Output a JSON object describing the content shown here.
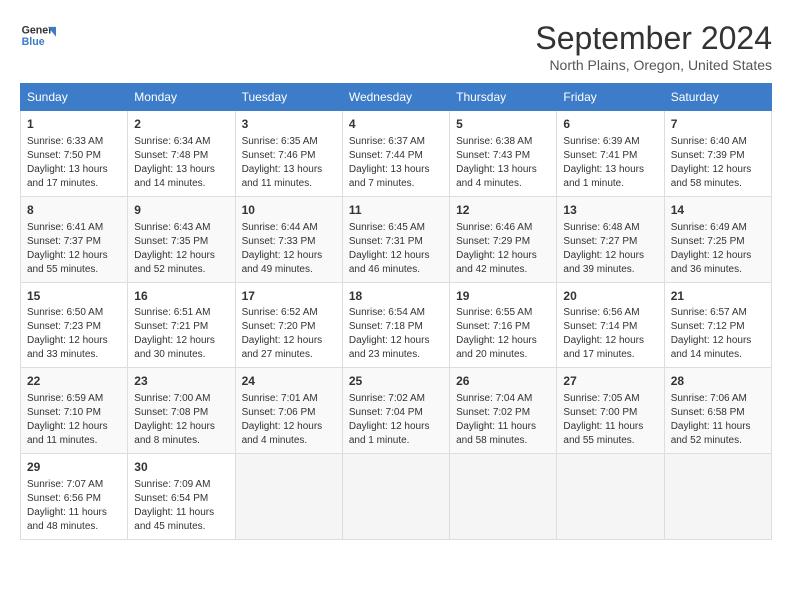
{
  "header": {
    "logo_line1": "General",
    "logo_line2": "Blue",
    "month": "September 2024",
    "location": "North Plains, Oregon, United States"
  },
  "weekdays": [
    "Sunday",
    "Monday",
    "Tuesday",
    "Wednesday",
    "Thursday",
    "Friday",
    "Saturday"
  ],
  "weeks": [
    [
      {
        "day": "1",
        "lines": [
          "Sunrise: 6:33 AM",
          "Sunset: 7:50 PM",
          "Daylight: 13 hours",
          "and 17 minutes."
        ]
      },
      {
        "day": "2",
        "lines": [
          "Sunrise: 6:34 AM",
          "Sunset: 7:48 PM",
          "Daylight: 13 hours",
          "and 14 minutes."
        ]
      },
      {
        "day": "3",
        "lines": [
          "Sunrise: 6:35 AM",
          "Sunset: 7:46 PM",
          "Daylight: 13 hours",
          "and 11 minutes."
        ]
      },
      {
        "day": "4",
        "lines": [
          "Sunrise: 6:37 AM",
          "Sunset: 7:44 PM",
          "Daylight: 13 hours",
          "and 7 minutes."
        ]
      },
      {
        "day": "5",
        "lines": [
          "Sunrise: 6:38 AM",
          "Sunset: 7:43 PM",
          "Daylight: 13 hours",
          "and 4 minutes."
        ]
      },
      {
        "day": "6",
        "lines": [
          "Sunrise: 6:39 AM",
          "Sunset: 7:41 PM",
          "Daylight: 13 hours",
          "and 1 minute."
        ]
      },
      {
        "day": "7",
        "lines": [
          "Sunrise: 6:40 AM",
          "Sunset: 7:39 PM",
          "Daylight: 12 hours",
          "and 58 minutes."
        ]
      }
    ],
    [
      {
        "day": "8",
        "lines": [
          "Sunrise: 6:41 AM",
          "Sunset: 7:37 PM",
          "Daylight: 12 hours",
          "and 55 minutes."
        ]
      },
      {
        "day": "9",
        "lines": [
          "Sunrise: 6:43 AM",
          "Sunset: 7:35 PM",
          "Daylight: 12 hours",
          "and 52 minutes."
        ]
      },
      {
        "day": "10",
        "lines": [
          "Sunrise: 6:44 AM",
          "Sunset: 7:33 PM",
          "Daylight: 12 hours",
          "and 49 minutes."
        ]
      },
      {
        "day": "11",
        "lines": [
          "Sunrise: 6:45 AM",
          "Sunset: 7:31 PM",
          "Daylight: 12 hours",
          "and 46 minutes."
        ]
      },
      {
        "day": "12",
        "lines": [
          "Sunrise: 6:46 AM",
          "Sunset: 7:29 PM",
          "Daylight: 12 hours",
          "and 42 minutes."
        ]
      },
      {
        "day": "13",
        "lines": [
          "Sunrise: 6:48 AM",
          "Sunset: 7:27 PM",
          "Daylight: 12 hours",
          "and 39 minutes."
        ]
      },
      {
        "day": "14",
        "lines": [
          "Sunrise: 6:49 AM",
          "Sunset: 7:25 PM",
          "Daylight: 12 hours",
          "and 36 minutes."
        ]
      }
    ],
    [
      {
        "day": "15",
        "lines": [
          "Sunrise: 6:50 AM",
          "Sunset: 7:23 PM",
          "Daylight: 12 hours",
          "and 33 minutes."
        ]
      },
      {
        "day": "16",
        "lines": [
          "Sunrise: 6:51 AM",
          "Sunset: 7:21 PM",
          "Daylight: 12 hours",
          "and 30 minutes."
        ]
      },
      {
        "day": "17",
        "lines": [
          "Sunrise: 6:52 AM",
          "Sunset: 7:20 PM",
          "Daylight: 12 hours",
          "and 27 minutes."
        ]
      },
      {
        "day": "18",
        "lines": [
          "Sunrise: 6:54 AM",
          "Sunset: 7:18 PM",
          "Daylight: 12 hours",
          "and 23 minutes."
        ]
      },
      {
        "day": "19",
        "lines": [
          "Sunrise: 6:55 AM",
          "Sunset: 7:16 PM",
          "Daylight: 12 hours",
          "and 20 minutes."
        ]
      },
      {
        "day": "20",
        "lines": [
          "Sunrise: 6:56 AM",
          "Sunset: 7:14 PM",
          "Daylight: 12 hours",
          "and 17 minutes."
        ]
      },
      {
        "day": "21",
        "lines": [
          "Sunrise: 6:57 AM",
          "Sunset: 7:12 PM",
          "Daylight: 12 hours",
          "and 14 minutes."
        ]
      }
    ],
    [
      {
        "day": "22",
        "lines": [
          "Sunrise: 6:59 AM",
          "Sunset: 7:10 PM",
          "Daylight: 12 hours",
          "and 11 minutes."
        ]
      },
      {
        "day": "23",
        "lines": [
          "Sunrise: 7:00 AM",
          "Sunset: 7:08 PM",
          "Daylight: 12 hours",
          "and 8 minutes."
        ]
      },
      {
        "day": "24",
        "lines": [
          "Sunrise: 7:01 AM",
          "Sunset: 7:06 PM",
          "Daylight: 12 hours",
          "and 4 minutes."
        ]
      },
      {
        "day": "25",
        "lines": [
          "Sunrise: 7:02 AM",
          "Sunset: 7:04 PM",
          "Daylight: 12 hours",
          "and 1 minute."
        ]
      },
      {
        "day": "26",
        "lines": [
          "Sunrise: 7:04 AM",
          "Sunset: 7:02 PM",
          "Daylight: 11 hours",
          "and 58 minutes."
        ]
      },
      {
        "day": "27",
        "lines": [
          "Sunrise: 7:05 AM",
          "Sunset: 7:00 PM",
          "Daylight: 11 hours",
          "and 55 minutes."
        ]
      },
      {
        "day": "28",
        "lines": [
          "Sunrise: 7:06 AM",
          "Sunset: 6:58 PM",
          "Daylight: 11 hours",
          "and 52 minutes."
        ]
      }
    ],
    [
      {
        "day": "29",
        "lines": [
          "Sunrise: 7:07 AM",
          "Sunset: 6:56 PM",
          "Daylight: 11 hours",
          "and 48 minutes."
        ]
      },
      {
        "day": "30",
        "lines": [
          "Sunrise: 7:09 AM",
          "Sunset: 6:54 PM",
          "Daylight: 11 hours",
          "and 45 minutes."
        ]
      },
      {
        "day": "",
        "lines": []
      },
      {
        "day": "",
        "lines": []
      },
      {
        "day": "",
        "lines": []
      },
      {
        "day": "",
        "lines": []
      },
      {
        "day": "",
        "lines": []
      }
    ]
  ]
}
